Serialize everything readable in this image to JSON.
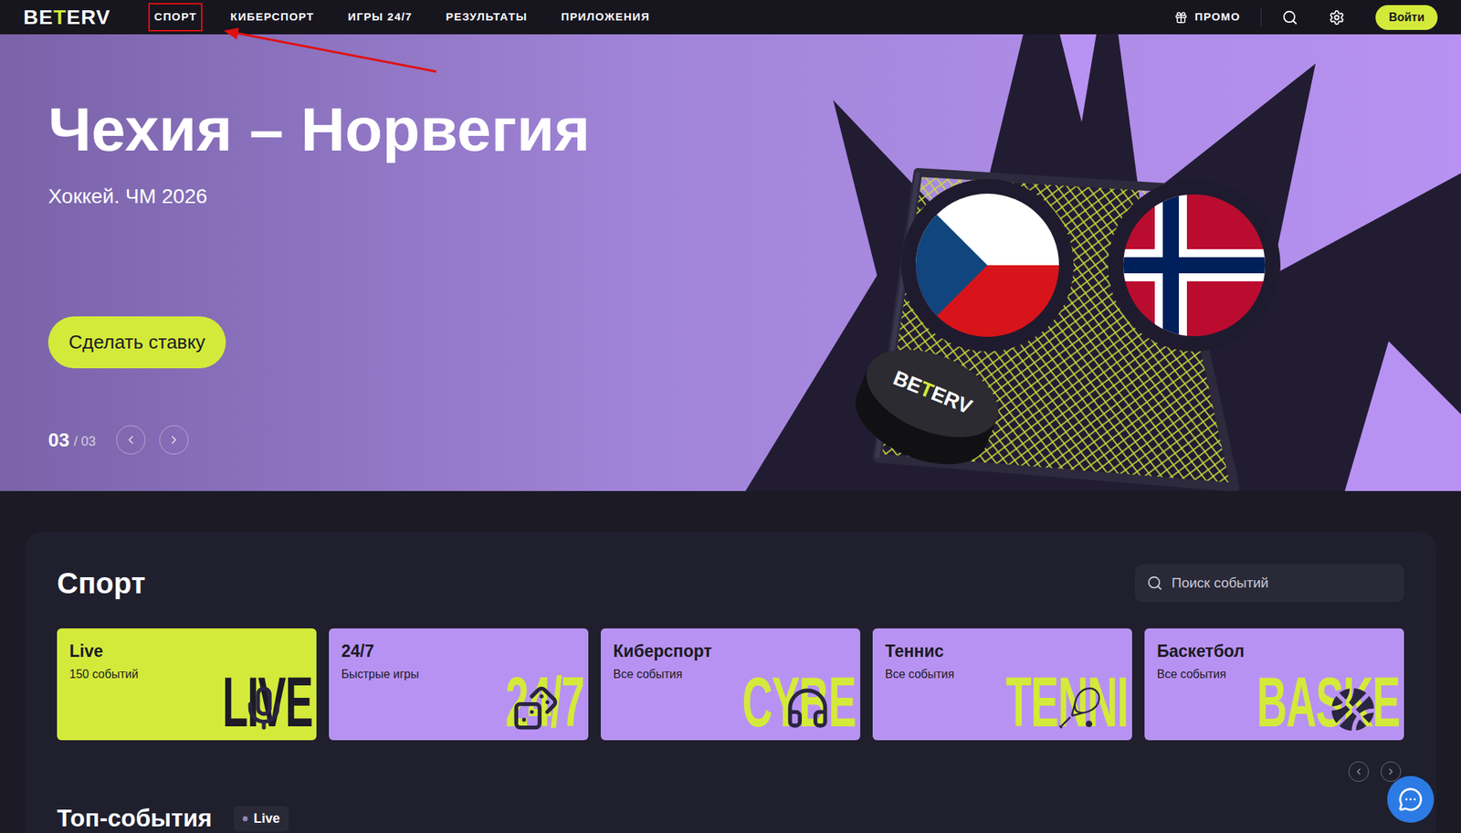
{
  "nav": {
    "logo": {
      "before": "BE",
      "mark": "T",
      "after": "ERV"
    },
    "items": [
      {
        "label": "СПОРТ",
        "highlighted": true
      },
      {
        "label": "КИБЕРСПОРТ",
        "highlighted": false
      },
      {
        "label": "ИГРЫ 24/7",
        "highlighted": false
      },
      {
        "label": "РЕЗУЛЬТАТЫ",
        "highlighted": false
      },
      {
        "label": "ПРИЛОЖЕНИЯ",
        "highlighted": false
      }
    ],
    "promo": "ПРОМО",
    "login": "Войти"
  },
  "hero": {
    "title": "Чехия – Норвегия",
    "subtitle": "Хоккей. ЧМ 2026",
    "button": "Сделать ставку",
    "slide": "03",
    "slides": "/ 03"
  },
  "sports": {
    "title": "Спорт",
    "search_placeholder": "Поиск событий",
    "cards": [
      {
        "title": "Live",
        "subtitle": "150 событий",
        "watermark": "LIVE",
        "color": "#d4ea3a",
        "watermark_color": "#1c1b27"
      },
      {
        "title": "24/7",
        "subtitle": "Быстрые игры",
        "watermark": "24/7",
        "color": "#b892f2",
        "watermark_color": "#d4ea3a"
      },
      {
        "title": "Киберспорт",
        "subtitle": "Все события",
        "watermark": "CYBE",
        "color": "#b892f2",
        "watermark_color": "#d4ea3a"
      },
      {
        "title": "Теннис",
        "subtitle": "Все события",
        "watermark": "TENNI",
        "color": "#b892f2",
        "watermark_color": "#d4ea3a"
      },
      {
        "title": "Баскетбол",
        "subtitle": "Все события",
        "watermark": "BASKE",
        "color": "#b892f2",
        "watermark_color": "#d4ea3a"
      }
    ]
  },
  "top_events": {
    "title": "Топ-события",
    "badge": "Live"
  }
}
